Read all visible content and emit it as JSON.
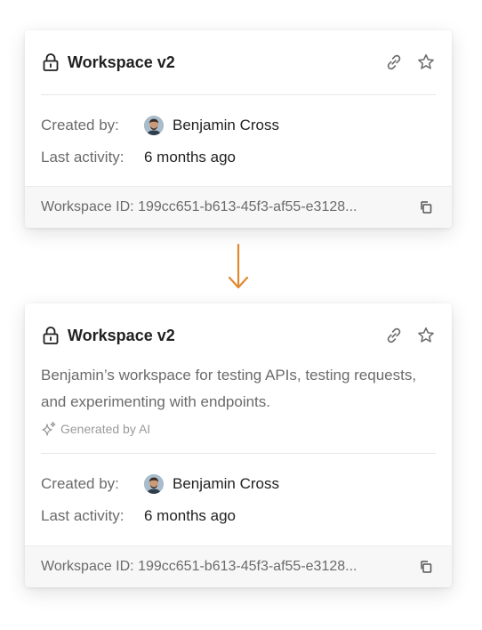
{
  "cards": [
    {
      "title": "Workspace v2",
      "created_by_label": "Created by:",
      "created_by_name": "Benjamin Cross",
      "last_activity_label": "Last activity:",
      "last_activity_value": "6 months ago",
      "workspace_id_text": "Workspace ID: 199cc651-b613-45f3-af55-e3128..."
    },
    {
      "title": "Workspace v2",
      "description": "Benjamin’s workspace for testing APIs, testing requests, and experimenting with endpoints.",
      "ai_badge": "Generated by AI",
      "created_by_label": "Created by:",
      "created_by_name": "Benjamin Cross",
      "last_activity_label": "Last activity:",
      "last_activity_value": "6 months ago",
      "workspace_id_text": "Workspace ID: 199cc651-b613-45f3-af55-e3128..."
    }
  ],
  "colors": {
    "arrow": "#e0892e",
    "text_primary": "#212121",
    "text_secondary": "#6b6b6b",
    "footer_bg": "#f7f7f7"
  },
  "icons": [
    "lock-icon",
    "link-icon",
    "star-icon",
    "copy-icon",
    "sparkle-icon",
    "arrow-down-icon"
  ]
}
